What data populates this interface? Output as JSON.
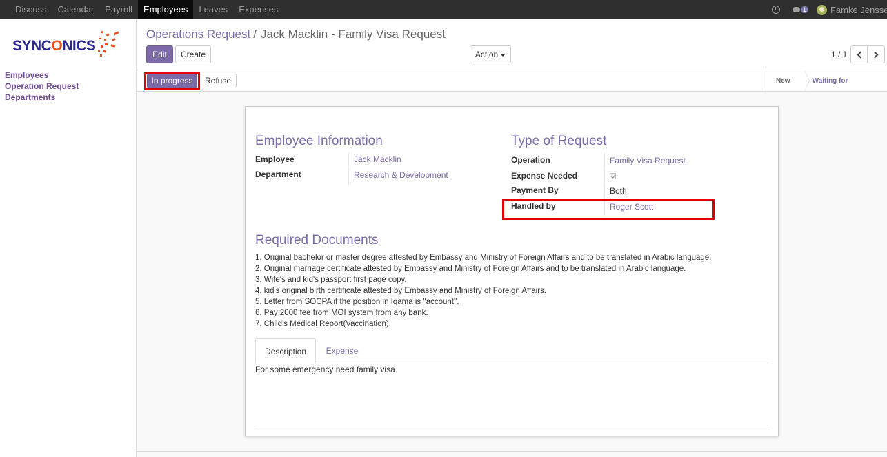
{
  "topbar": {
    "menu": [
      "Discuss",
      "Calendar",
      "Payroll",
      "Employees",
      "Leaves",
      "Expenses"
    ],
    "active_index": 3,
    "chat_count": "1",
    "user_name": "Famke Jenssen"
  },
  "sidebar": {
    "logo_text_1": "SYNC",
    "logo_text_2": "O",
    "logo_text_3": "NICS",
    "items": [
      "Employees",
      "Operation Request",
      "Departments"
    ]
  },
  "control_panel": {
    "breadcrumb_parent": "Operations Request",
    "breadcrumb_sep": "/",
    "breadcrumb_current": "Jack Macklin - Family Visa Request",
    "edit_label": "Edit",
    "create_label": "Create",
    "action_label": "Action",
    "pager_text": "1 / 1"
  },
  "statusbar": {
    "in_progress_label": "In progress",
    "refuse_label": "Refuse",
    "stages": [
      "New",
      "Waiting for Approval"
    ]
  },
  "form": {
    "employee_info_title": "Employee Information",
    "employee_label": "Employee",
    "employee_value": "Jack Macklin",
    "department_label": "Department",
    "department_value": "Research & Development",
    "type_title": "Type of Request",
    "operation_label": "Operation",
    "operation_value": "Family Visa Request",
    "expense_needed_label": "Expense Needed",
    "expense_needed_checked": true,
    "payment_by_label": "Payment By",
    "payment_by_value": "Both",
    "handled_by_label": "Handled by",
    "handled_by_value": "Roger Scott",
    "required_docs_title": "Required Documents",
    "required_docs": [
      "1. Original bachelor or master degree attested by Embassy and Ministry of Foreign Affairs and to be translated in Arabic language.",
      "2. Original marriage certificate attested by Embassy and Ministry of Foreign Affairs and to be translated in Arabic language.",
      "3. Wife's and kid's passport first page copy.",
      "4. kid's original birth certificate attested by Embassy and Ministry of Foreign Affairs.",
      "5. Letter from SOCPA if the position in Iqama is ''account''.",
      "6. Pay 2000 fee from MOI system from any bank.",
      "7. Child's Medical Report(Vaccination)."
    ],
    "tabs": [
      "Description",
      "Expense"
    ],
    "description_text": "For some emergency need family visa."
  },
  "colors": {
    "accent": "#7c6aa8",
    "topbar": "#2f2f2f",
    "highlight_box": "#e00000",
    "logo_blue": "#2b2a8c",
    "logo_orange": "#e8501e"
  }
}
